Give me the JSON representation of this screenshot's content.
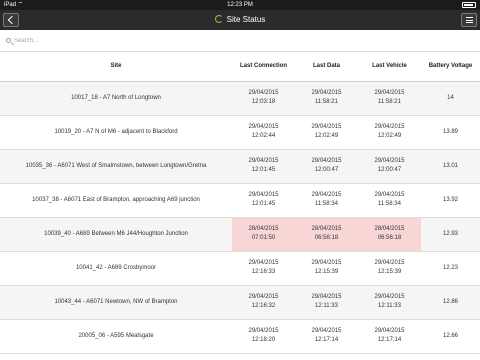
{
  "status_bar": {
    "carrier": "iPad ⌔",
    "time": "12:23 PM"
  },
  "nav": {
    "title": "Site Status",
    "back_icon": "chevron-left-icon",
    "menu_icon": "hamburger-menu-icon"
  },
  "search": {
    "placeholder": "Search..."
  },
  "table": {
    "headers": {
      "site": "Site",
      "last_connection": "Last Connection",
      "last_data": "Last Data",
      "last_vehicle": "Last Vehicle",
      "battery_voltage": "Battery Voltage"
    },
    "alert_color": "#f9d6d6",
    "rows": [
      {
        "site": "10017_18 - A7 North of Longtown",
        "conn_date": "29/04/2015",
        "conn_time": "12:03:18",
        "data_date": "29/04/2015",
        "data_time": "11:58:21",
        "veh_date": "29/04/2015",
        "veh_time": "11:58:21",
        "voltage": "14",
        "alert": false
      },
      {
        "site": "10019_20 - A7 N of M6 - adjacent to Blackford",
        "conn_date": "29/04/2015",
        "conn_time": "12:02:44",
        "data_date": "29/04/2015",
        "data_time": "12:02:49",
        "veh_date": "29/04/2015",
        "veh_time": "12:02:49",
        "voltage": "13.89",
        "alert": false
      },
      {
        "site": "10035_36 - A6071 West of Smalmstown, between Longtown/Gretna",
        "conn_date": "29/04/2015",
        "conn_time": "12:01:45",
        "data_date": "29/04/2015",
        "data_time": "12:00:47",
        "veh_date": "29/04/2015",
        "veh_time": "12:00:47",
        "voltage": "13.01",
        "alert": false
      },
      {
        "site": "10037_38 - A6071 East of Brampton, approaching A69 junction",
        "conn_date": "29/04/2015",
        "conn_time": "12:01:45",
        "data_date": "29/04/2015",
        "data_time": "11:58:34",
        "veh_date": "29/04/2015",
        "veh_time": "11:58:34",
        "voltage": "13.92",
        "alert": false
      },
      {
        "site": "10039_40 - A689 Between M6 J44/Houghton Junction",
        "conn_date": "28/04/2015",
        "conn_time": "07:01:50",
        "data_date": "28/04/2015",
        "data_time": "06:56:18",
        "veh_date": "28/04/2015",
        "veh_time": "06:56:18",
        "voltage": "12.93",
        "alert": true
      },
      {
        "site": "10041_42 - A689 Crosbymoor",
        "conn_date": "29/04/2015",
        "conn_time": "12:16:33",
        "data_date": "29/04/2015",
        "data_time": "12:15:39",
        "veh_date": "29/04/2015",
        "veh_time": "12:15:39",
        "voltage": "12.23",
        "alert": false
      },
      {
        "site": "10043_44 - A6071 Newtown, NW of Brampton",
        "conn_date": "29/04/2015",
        "conn_time": "12:16:32",
        "data_date": "29/04/2015",
        "data_time": "12:11:33",
        "veh_date": "29/04/2015",
        "veh_time": "12:11:33",
        "voltage": "12.86",
        "alert": false
      },
      {
        "site": "20005_06 - A595 Mealsgate",
        "conn_date": "29/04/2015",
        "conn_time": "12:18:20",
        "data_date": "29/04/2015",
        "data_time": "12:17:14",
        "veh_date": "29/04/2015",
        "veh_time": "12:17:14",
        "voltage": "12.66",
        "alert": false
      }
    ]
  }
}
